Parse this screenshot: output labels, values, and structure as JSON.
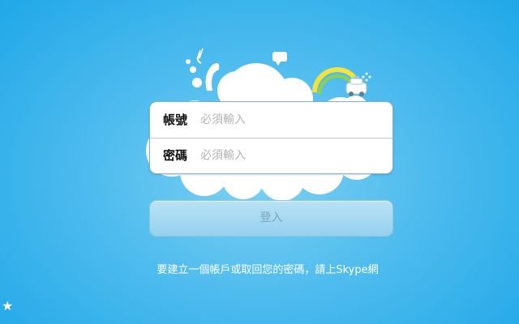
{
  "login": {
    "account_label": "帳號",
    "account_placeholder": "必須輸入",
    "password_label": "密碼",
    "password_placeholder": "必須輸入",
    "submit_label": "登入"
  },
  "help": {
    "text": "要建立一個帳戶或取回您的密碼，請上Skype網"
  },
  "icons": {
    "star": "★",
    "scene": [
      "cloud",
      "rainbow",
      "taxi",
      "speech-bubble",
      "water-splash"
    ]
  },
  "colors": {
    "background": "#4fbcee",
    "button": "#a9dbf2",
    "button_text": "#7ba6bc",
    "rainbow_yellow": "#f2e33a",
    "rainbow_green": "#8fd14f"
  }
}
